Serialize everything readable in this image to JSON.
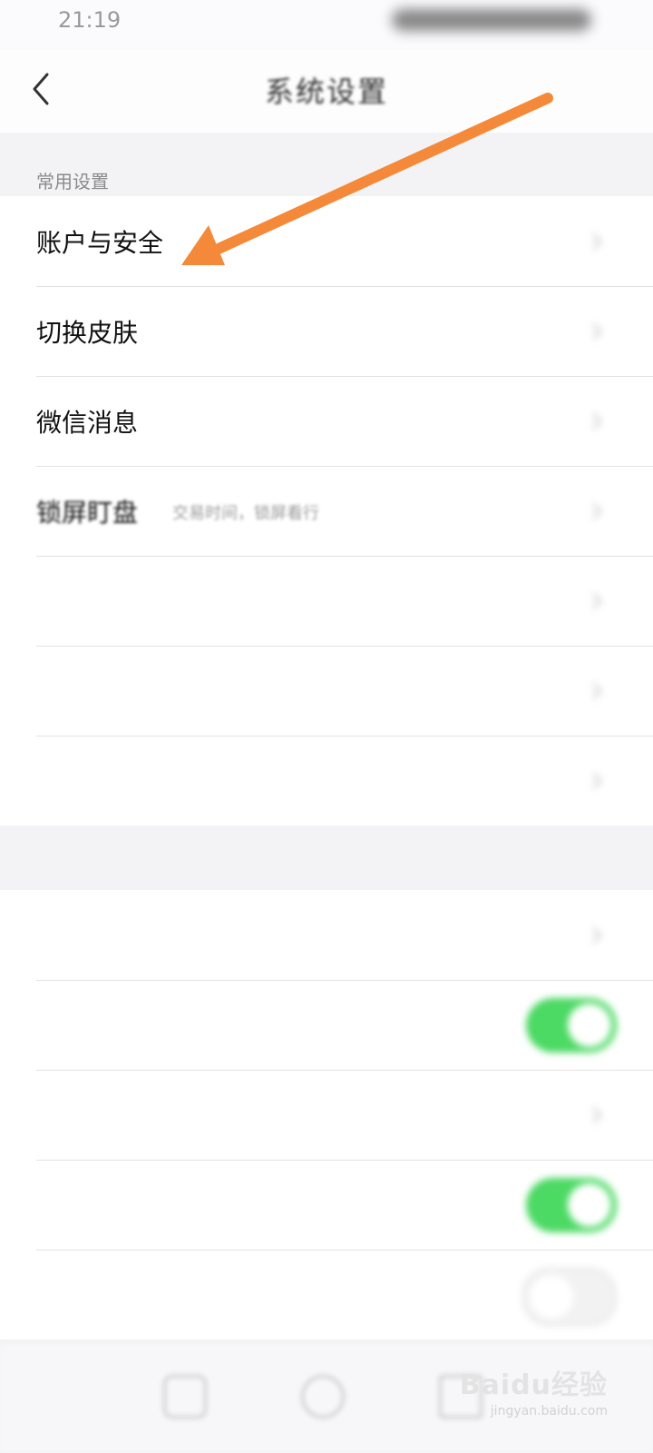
{
  "status_bar": {
    "time": "21:19"
  },
  "header": {
    "title": "系统设置"
  },
  "sections": {
    "common": {
      "label": "常用设置"
    },
    "second": {
      "label": ""
    }
  },
  "rows": {
    "account_security": {
      "label": "账户与安全"
    },
    "switch_skin": {
      "label": "切换皮肤",
      "value": ""
    },
    "wechat_messages": {
      "label": "微信消息"
    },
    "lock_screen": {
      "label": "锁屏盯盘",
      "desc": "交易时间，锁屏看行",
      "value": ""
    },
    "row5": {
      "label": "",
      "value": ""
    },
    "row6": {
      "label": "",
      "value": ""
    },
    "row7": {
      "label": ""
    },
    "row8": {
      "label": ""
    },
    "row9": {
      "label": "",
      "toggle_on": true
    },
    "row10": {
      "label": "",
      "value": ""
    },
    "row11": {
      "label": "",
      "desc": "",
      "toggle_on": true
    },
    "row12": {
      "label": "",
      "toggle_on": false
    }
  },
  "annotation": {
    "arrow_color": "#f5893a"
  },
  "colors": {
    "toggle_on": "#4cd964",
    "background": "#f3f3f6",
    "card": "#ffffff"
  },
  "watermark": {
    "logo": "Baidu经验",
    "url": "jingyan.baidu.com"
  }
}
